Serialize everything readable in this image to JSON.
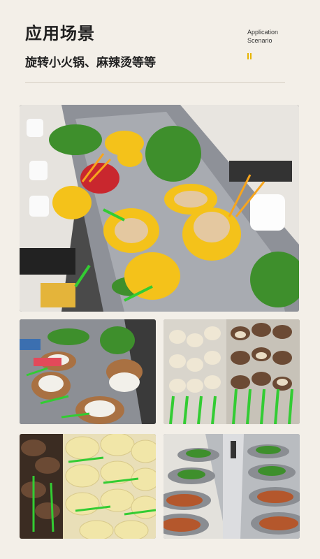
{
  "header": {
    "title": "应用场景",
    "subtitle": "旋转小火锅、麻辣烫等等",
    "en_line1": "Application",
    "en_line2": "Scenario"
  },
  "photos": [
    {
      "id": "main",
      "desc": "conveyor belt hot pot with yellow bowls"
    },
    {
      "id": "grid-1",
      "desc": "skewers on plates"
    },
    {
      "id": "grid-2",
      "desc": "green skewers with mushrooms"
    },
    {
      "id": "grid-3",
      "desc": "sliced potato and meat skewers"
    },
    {
      "id": "grid-4",
      "desc": "conveyor line of skewers"
    }
  ],
  "colors": {
    "accent": "#e6b400",
    "bowl": "#f4c21a",
    "skewer": "#33cc33",
    "steel": "#8e9198"
  }
}
